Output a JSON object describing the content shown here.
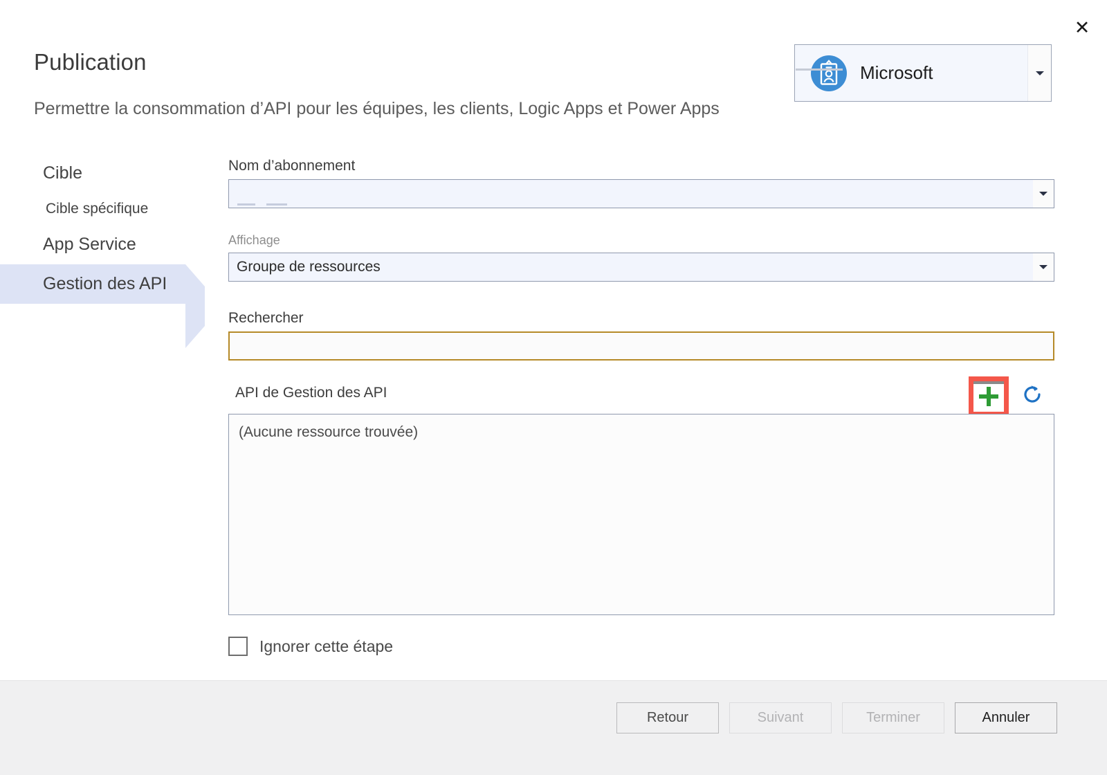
{
  "dialog": {
    "title": "Publication",
    "subtitle": "Permettre la consommation d’API pour les équipes, les clients, Logic Apps et Power Apps",
    "close_label": "✕"
  },
  "account": {
    "name": "Microsoft",
    "icon": "account-badge-icon",
    "accent_color": "#3d8dd4"
  },
  "sidebar": {
    "items": [
      {
        "label": "Cible",
        "selected": false,
        "size": "lg"
      },
      {
        "label": "Cible spécifique",
        "selected": false,
        "size": "sm"
      },
      {
        "label": "App Service",
        "selected": false,
        "size": "lg"
      },
      {
        "label": "Gestion des API",
        "selected": true,
        "size": "lg"
      }
    ]
  },
  "form": {
    "subscription": {
      "label": "Nom d’abonnement",
      "value": "",
      "redacted": true
    },
    "display": {
      "label": "Affichage",
      "value": "Groupe de ressources",
      "options": [
        "Groupe de ressources"
      ]
    },
    "search": {
      "label": "Rechercher",
      "value": "",
      "placeholder": "",
      "border_color": "#b58a28"
    },
    "resource_list": {
      "label": "API de Gestion des API",
      "empty_text": "(Aucune ressource trouvée)",
      "items": []
    },
    "toolbar": {
      "add_icon": "plus-icon",
      "add_highlight_color": "#f4574a",
      "add_icon_color": "#2e9b35",
      "refresh_icon": "refresh-icon",
      "refresh_icon_color": "#1f72c4"
    },
    "skip_step": {
      "label": "Ignorer cette étape",
      "checked": false
    }
  },
  "footer": {
    "buttons": [
      {
        "label": "Retour",
        "state": "enabled"
      },
      {
        "label": "Suivant",
        "state": "disabled"
      },
      {
        "label": "Terminer",
        "state": "disabled"
      },
      {
        "label": "Annuler",
        "state": "enabled"
      }
    ]
  }
}
